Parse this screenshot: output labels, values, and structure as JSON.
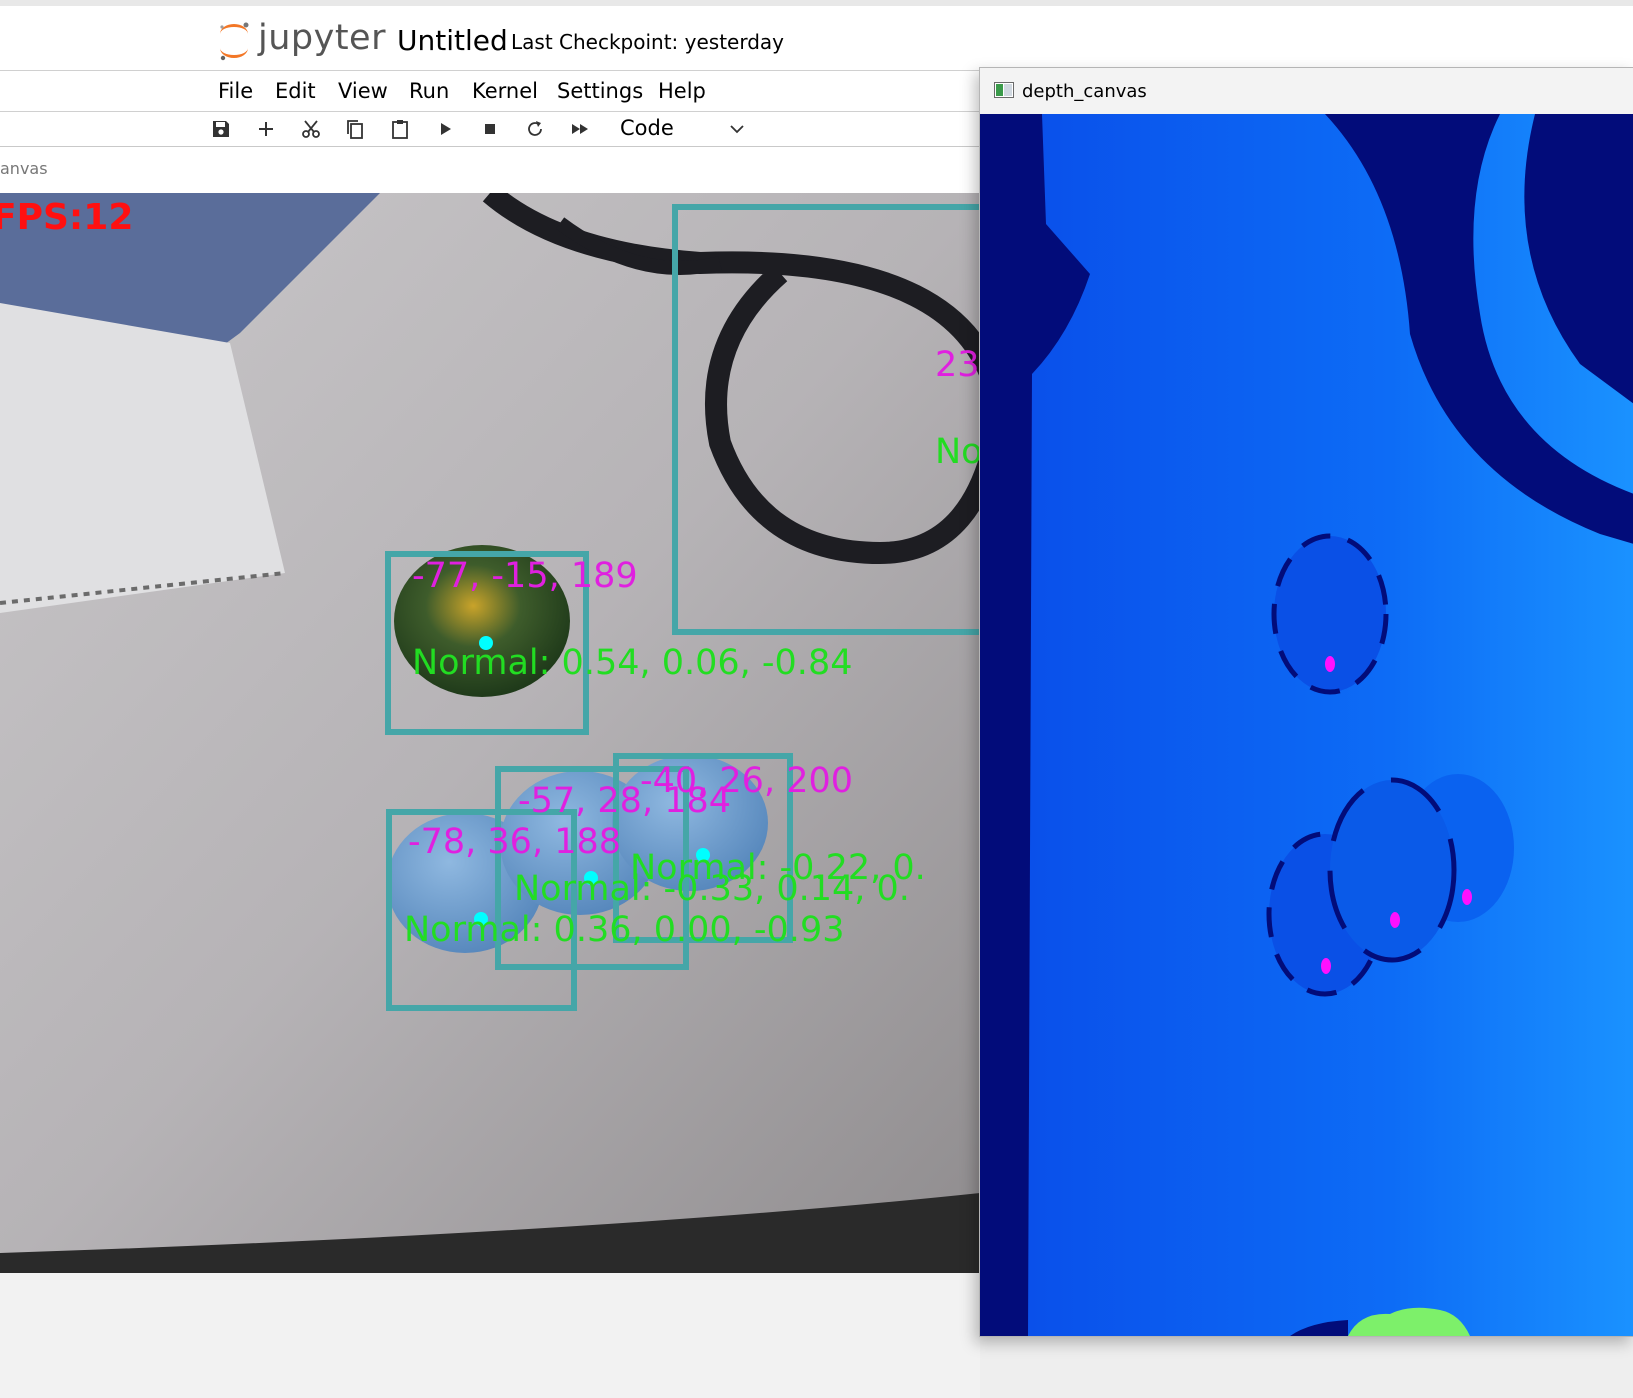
{
  "jupyter": {
    "logo_text": "jupyter",
    "notebook_title": "Untitled",
    "checkpoint": "Last Checkpoint: yesterday"
  },
  "menu": [
    "File",
    "Edit",
    "View",
    "Run",
    "Kernel",
    "Settings",
    "Help"
  ],
  "toolbar": {
    "icons": [
      "save-icon",
      "add-cell-icon",
      "cut-icon",
      "copy-icon",
      "paste-icon",
      "run-icon",
      "stop-icon",
      "restart-icon",
      "fast-forward-icon"
    ],
    "cell_type": "Code"
  },
  "canvas_window": {
    "title": "anvas",
    "fps": "FPS:12",
    "detections": [
      {
        "position": "23",
        "normal": "No"
      },
      {
        "position": "-77, -15, 189",
        "normal": "Normal: 0.54, 0.06, -0.84"
      },
      {
        "position": "-40, 26, 200",
        "normal": "Normal: -0.22, 0."
      },
      {
        "position": "-57, 28, 184",
        "normal": "Normal: -0.33, 0.14, 0."
      },
      {
        "position": "-78, 36, 188",
        "normal": "Normal: 0.36, 0.00, -0.93"
      }
    ]
  },
  "depth_window": {
    "title": "depth_canvas"
  },
  "colors": {
    "box": "#45a6a8",
    "position_text": "#e020e0",
    "normal_text": "#22dd22",
    "center_dot": "#00ffff",
    "fps_text": "#ff1010",
    "depth_far": "#020c7a",
    "depth_mid": "#0a5af0",
    "depth_near": "#1a8cff",
    "depth_marker": "#ff10ff"
  }
}
